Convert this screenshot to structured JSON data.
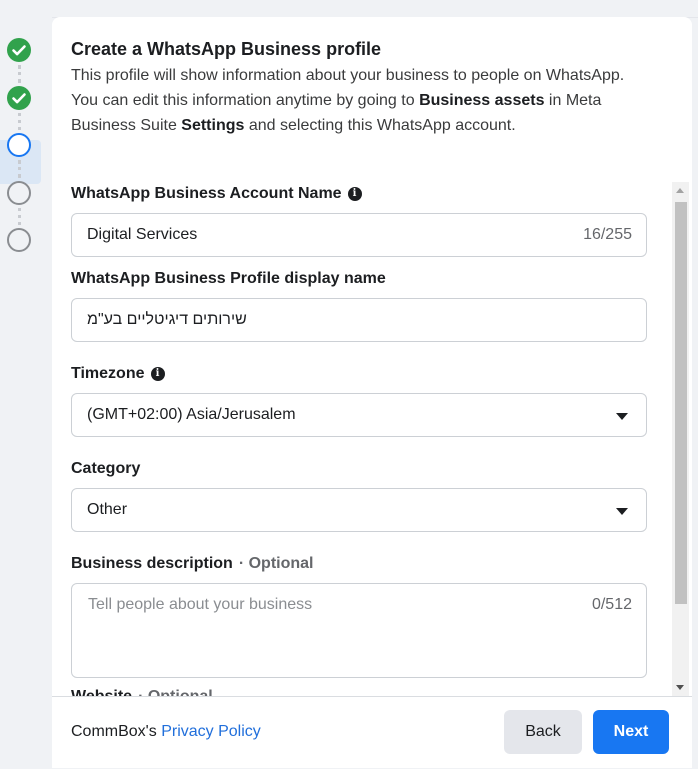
{
  "stepper": {
    "steps": [
      "complete",
      "complete",
      "active",
      "pending",
      "pending"
    ]
  },
  "header": {
    "title": "Create a WhatsApp Business profile",
    "intro_1": "This profile will show information about your business to people on WhatsApp. You can edit this information anytime by going to ",
    "intro_bold_1": "Business assets",
    "intro_2": " in Meta Business Suite ",
    "intro_bold_2": "Settings",
    "intro_3": " and selecting this WhatsApp account."
  },
  "form": {
    "account_name": {
      "label": "WhatsApp Business Account Name",
      "value": "Digital Services",
      "counter": "16/255"
    },
    "display_name": {
      "label": "WhatsApp Business Profile display name",
      "value": "שירותים דיגיטליים בע\"מ"
    },
    "timezone": {
      "label": "Timezone",
      "value": "(GMT+02:00) Asia/Jerusalem"
    },
    "category": {
      "label": "Category",
      "value": "Other"
    },
    "description": {
      "label": "Business description",
      "optional": "· Optional",
      "placeholder": "Tell people about your business",
      "counter": "0/512"
    },
    "website": {
      "label": "Website",
      "optional": "· Optional"
    }
  },
  "footer": {
    "policy_prefix": "CommBox's ",
    "policy_link": "Privacy Policy",
    "back_label": "Back",
    "next_label": "Next"
  },
  "colors": {
    "primary": "#1877f2",
    "success": "#31a24c",
    "link": "#216fdb"
  }
}
